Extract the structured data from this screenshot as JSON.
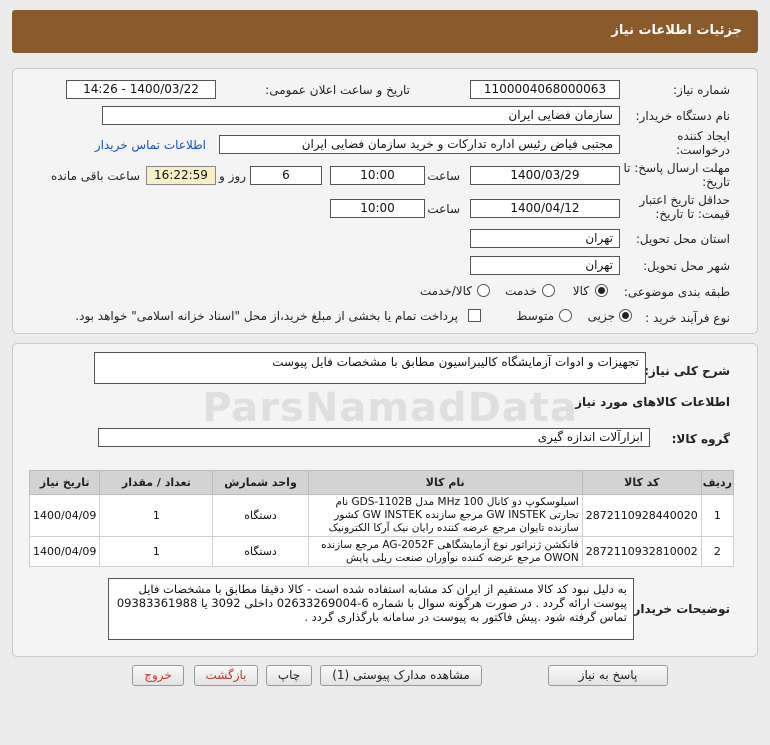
{
  "header": {
    "title": "جزئیات اطلاعات نیاز"
  },
  "form": {
    "need_number_label": "شماره نیاز:",
    "need_number": "1100004068000063",
    "announce_label": "تاریخ و ساعت اعلان عمومی:",
    "announce_value": "1400/03/22 - 14:26",
    "buyer_org_label": "نام دستگاه خریدار:",
    "buyer_org": "سازمان فضایی ایران",
    "creator_label": "ایجاد کننده درخواست:",
    "creator": "مجتبی  فیاض رئیس اداره تدارکات و خرید سازمان فضایی ایران",
    "contact_link": "اطلاعات تماس خریدار",
    "reply_deadline_label": "مهلت ارسال پاسخ: تا تاریخ:",
    "reply_date": "1400/03/29",
    "time_label": "ساعت",
    "reply_time": "10:00",
    "days": "6",
    "days_label": "روز و",
    "remaining": "16:22:59",
    "remaining_label": "ساعت باقی مانده",
    "validity_label": "حداقل تاریخ اعتبار قیمت: تا تاریخ:",
    "validity_date": "1400/04/12",
    "validity_time": "10:00",
    "province_label": "استان محل تحویل:",
    "province": "تهران",
    "city_label": "شهر محل تحویل:",
    "city": "تهران",
    "category_label": "طبقه بندی موضوعی:",
    "category_options": [
      "کالا",
      "خدمت",
      "کالا/خدمت"
    ],
    "process_label": "نوع فرآیند خرید :",
    "process_options": [
      "جزیی",
      "متوسط"
    ],
    "payment_note": "پرداخت تمام یا بخشی از مبلغ خرید،از محل \"اسناد خزانه اسلامی\" خواهد بود."
  },
  "summary": {
    "label": "شرح کلی نیاز:",
    "value": "تجهیزات و ادوات آزمایشگاه کالیبراسیون مطابق با مشخصات فایل پیوست"
  },
  "goods_info_title": "اطلاعات کالاهای مورد نیاز",
  "goods_group": {
    "label": "گروه کالا:",
    "value": "ابزارآلات اندازه گیری"
  },
  "table": {
    "headers": [
      "ردیف",
      "کد کالا",
      "نام کالا",
      "واحد شمارش",
      "تعداد / مقدار",
      "تاریخ نیاز"
    ],
    "rows": [
      {
        "row": "1",
        "code": "2872110928440020",
        "name": "اسیلوسکوپ دو کانال MHz 100 مدل GDS-1102B نام تجارتی GW INSTEK مرجع سازنده GW INSTEK کشور سازنده تایوان مرجع عرضه کننده رایان نیک آرکا الکترونیک",
        "unit": "دستگاه",
        "qty": "1",
        "date": "1400/04/09"
      },
      {
        "row": "2",
        "code": "2872110932810002",
        "name": "فانکشن ژنراتور نوع آزمایشگاهی AG-2052F مرجع سازنده OWON مرجع عرضه کننده نوآوران صنعت ریلی پایش",
        "unit": "دستگاه",
        "qty": "1",
        "date": "1400/04/09"
      }
    ]
  },
  "buyer_desc": {
    "label": "توضیحات خریدار:",
    "value": "به دلیل نبود کد کالا مستقیم از ایران کد مشابه استفاده شده است - کالا دقیقا مطابق با مشخصات فایل پیوست ارائه گردد . در صورت هرگونه سوال با شماره 6-02633269004 داخلی 3092 یا 09383361988 تماس گرفته شود .پیش فاکتور به پیوست در سامانه بارگذاری گردد ."
  },
  "buttons": {
    "reply": "پاسخ به نیاز",
    "attachments": "مشاهده مدارک پیوستی (1)",
    "print": "چاپ",
    "back": "بازگشت",
    "exit": "خروج"
  },
  "watermark": "ParsNamadData",
  "colors": {
    "header_bg": "#8b5a2b",
    "timer_bg": "#f7f0c6",
    "link": "#1a4fb5",
    "exit_text": "#c0392b"
  }
}
